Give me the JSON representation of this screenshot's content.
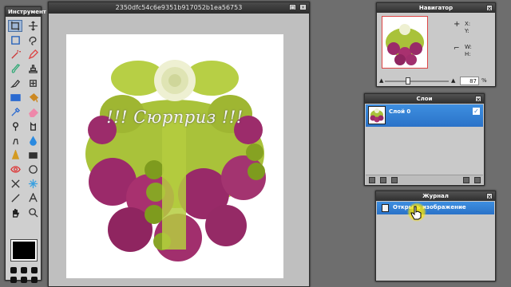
{
  "tools": {
    "title": "Инструмент",
    "items": [
      {
        "name": "crop-icon"
      },
      {
        "name": "move-icon"
      },
      {
        "name": "marquee-icon"
      },
      {
        "name": "lasso-icon"
      },
      {
        "name": "magic-wand-icon"
      },
      {
        "name": "pencil-icon"
      },
      {
        "name": "brush-icon"
      },
      {
        "name": "clone-stamp-icon"
      },
      {
        "name": "color-replace-icon"
      },
      {
        "name": "spot-heal-icon"
      },
      {
        "name": "gradient-icon"
      },
      {
        "name": "paint-bucket-icon"
      },
      {
        "name": "color-picker-icon"
      },
      {
        "name": "eraser-icon"
      },
      {
        "name": "dodge-icon"
      },
      {
        "name": "burn-icon"
      },
      {
        "name": "smudge-icon"
      },
      {
        "name": "blur-icon"
      },
      {
        "name": "sharpen-icon"
      },
      {
        "name": "sponge-icon"
      },
      {
        "name": "red-eye-icon"
      },
      {
        "name": "bloat-icon"
      },
      {
        "name": "pinch-icon"
      },
      {
        "name": "sparkle-icon"
      },
      {
        "name": "line-icon"
      },
      {
        "name": "text-icon"
      },
      {
        "name": "hand-icon"
      },
      {
        "name": "zoom-icon"
      }
    ]
  },
  "document": {
    "title": "2350dfc54c6e9351b917052b1ea56753",
    "image_caption": "!!! Сюрприз !!!"
  },
  "navigator": {
    "title": "Навигатор",
    "x_label": "X:",
    "y_label": "Y:",
    "w_label": "W:",
    "h_label": "H:",
    "zoom": "87",
    "zoom_fraction": 0.36
  },
  "layers": {
    "title": "Слои",
    "items": [
      {
        "name": "Слой 0",
        "visible": true
      }
    ]
  },
  "history": {
    "title": "Журнал",
    "items": [
      "Открыть изображение"
    ]
  },
  "colors": {
    "panel_bg": "#c9c9c9",
    "workspace": "#6e6e6e",
    "selection_blue": "#2a72c8",
    "highlight": "#ffe600"
  }
}
